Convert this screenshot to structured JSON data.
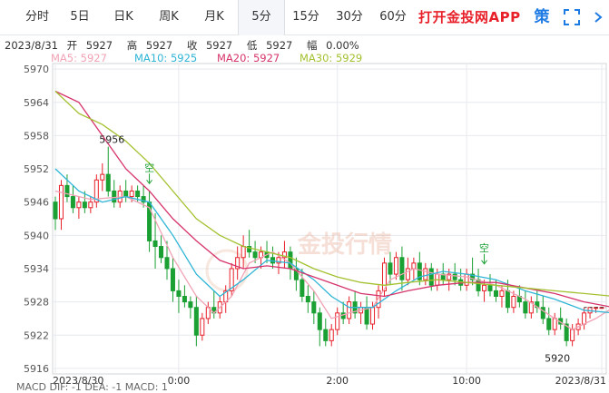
{
  "tabs": [
    {
      "label": "分时",
      "active": false
    },
    {
      "label": "5日",
      "active": false
    },
    {
      "label": "日K",
      "active": false
    },
    {
      "label": "周K",
      "active": false
    },
    {
      "label": "月K",
      "active": false
    },
    {
      "label": "5分",
      "active": true
    },
    {
      "label": "15分",
      "active": false
    },
    {
      "label": "30分",
      "active": false
    },
    {
      "label": "60分",
      "active": false
    }
  ],
  "app_link": "打开金投网APP",
  "strategy_icon_label": "策",
  "icons": {
    "strategy": "strategy-icon",
    "fullscreen": "fullscreen-icon"
  },
  "info": {
    "date": "2023/8/31",
    "open_label": "开",
    "open": "5927",
    "high_label": "高",
    "high": "5927",
    "close_label": "收",
    "close": "5927",
    "low_label": "低",
    "low": "5927",
    "amp_label": "幅",
    "amp": "0.00%"
  },
  "ma_legend": [
    {
      "label": "MA5: 5927",
      "color": "#f0a3b5"
    },
    {
      "label": "MA10: 5925",
      "color": "#2fb5d6"
    },
    {
      "label": "MA20: 5927",
      "color": "#d6336c"
    },
    {
      "label": "MA30: 5929",
      "color": "#a3c130"
    }
  ],
  "bottom_partial": "MACD  DIF: -1    DEA: -1    MACD: 1",
  "chart_data": {
    "type": "candlestick",
    "ylim": [
      5915,
      5971
    ],
    "yticks": [
      5916,
      5922,
      5928,
      5934,
      5940,
      5946,
      5952,
      5958,
      5964,
      5970
    ],
    "xticks": [
      {
        "label": "2023/8/30",
        "index": 0
      },
      {
        "label": "0:00",
        "index": 21
      },
      {
        "label": "2:00",
        "index": 48
      },
      {
        "label": "10:00",
        "index": 70
      },
      {
        "label": "2023/8/31",
        "index": 93
      }
    ],
    "annotations": [
      {
        "text": "5956",
        "index": 9,
        "value": 5956,
        "kind": "high"
      },
      {
        "text": "5920",
        "index": 87,
        "value": 5920,
        "kind": "low"
      },
      {
        "text": "空",
        "index": 16,
        "value": 5950,
        "kind": "signal"
      },
      {
        "text": "空",
        "index": 73,
        "value": 5935.5,
        "kind": "signal"
      }
    ],
    "last_price": 5927,
    "colors": {
      "up": "#e8202a",
      "down": "#1aa033",
      "grid": "#e6e9ee",
      "axis": "#999999"
    },
    "candles": [
      [
        5946,
        5947,
        5941,
        5943
      ],
      [
        5943,
        5950,
        5941,
        5949
      ],
      [
        5949,
        5951,
        5946,
        5947
      ],
      [
        5947,
        5949,
        5944,
        5945
      ],
      [
        5945,
        5947,
        5943,
        5946
      ],
      [
        5946,
        5948,
        5944,
        5945
      ],
      [
        5945,
        5947,
        5944,
        5946
      ],
      [
        5946,
        5951,
        5945,
        5950
      ],
      [
        5950,
        5953,
        5948,
        5951
      ],
      [
        5951,
        5956,
        5947,
        5948
      ],
      [
        5948,
        5950,
        5945,
        5946
      ],
      [
        5946,
        5949,
        5945,
        5948
      ],
      [
        5948,
        5950,
        5946,
        5947
      ],
      [
        5947,
        5949,
        5946,
        5948
      ],
      [
        5948,
        5949,
        5946,
        5947
      ],
      [
        5947,
        5949,
        5945,
        5946
      ],
      [
        5946,
        5948,
        5937,
        5939
      ],
      [
        5939,
        5944,
        5934,
        5938
      ],
      [
        5938,
        5940,
        5935,
        5936
      ],
      [
        5936,
        5939,
        5932,
        5934
      ],
      [
        5934,
        5936,
        5928,
        5930
      ],
      [
        5930,
        5932,
        5926,
        5929
      ],
      [
        5929,
        5931,
        5927,
        5928
      ],
      [
        5928,
        5929,
        5925,
        5927
      ],
      [
        5927,
        5929,
        5920,
        5922
      ],
      [
        5922,
        5926,
        5921,
        5925
      ],
      [
        5925,
        5928,
        5924,
        5927
      ],
      [
        5927,
        5930,
        5925,
        5926
      ],
      [
        5926,
        5929,
        5925,
        5928
      ],
      [
        5928,
        5931,
        5926,
        5930
      ],
      [
        5930,
        5935,
        5929,
        5934
      ],
      [
        5934,
        5938,
        5932,
        5936
      ],
      [
        5936,
        5940,
        5934,
        5938
      ],
      [
        5938,
        5941,
        5936,
        5937
      ],
      [
        5937,
        5939,
        5935,
        5936
      ],
      [
        5936,
        5938,
        5934,
        5937
      ],
      [
        5937,
        5939,
        5935,
        5936
      ],
      [
        5936,
        5938,
        5934,
        5935
      ],
      [
        5935,
        5937,
        5933,
        5936
      ],
      [
        5936,
        5939,
        5934,
        5937
      ],
      [
        5937,
        5938,
        5932,
        5934
      ],
      [
        5934,
        5936,
        5930,
        5932
      ],
      [
        5932,
        5934,
        5928,
        5929
      ],
      [
        5929,
        5931,
        5926,
        5928
      ],
      [
        5928,
        5930,
        5924,
        5926
      ],
      [
        5926,
        5927,
        5920,
        5923
      ],
      [
        5923,
        5925,
        5920,
        5921
      ],
      [
        5921,
        5924,
        5920,
        5923
      ],
      [
        5923,
        5927,
        5922,
        5926
      ],
      [
        5926,
        5928,
        5924,
        5925
      ],
      [
        5925,
        5929,
        5924,
        5928
      ],
      [
        5928,
        5930,
        5925,
        5926
      ],
      [
        5926,
        5928,
        5924,
        5927
      ],
      [
        5927,
        5929,
        5923,
        5924
      ],
      [
        5924,
        5928,
        5923,
        5927
      ],
      [
        5927,
        5931,
        5925,
        5930
      ],
      [
        5930,
        5936,
        5929,
        5935
      ],
      [
        5935,
        5937,
        5931,
        5933
      ],
      [
        5933,
        5937,
        5932,
        5936
      ],
      [
        5936,
        5938,
        5930,
        5932
      ],
      [
        5932,
        5936,
        5931,
        5934
      ],
      [
        5934,
        5936,
        5932,
        5935
      ],
      [
        5935,
        5937,
        5931,
        5932
      ],
      [
        5932,
        5935,
        5931,
        5934
      ],
      [
        5934,
        5935,
        5930,
        5931
      ],
      [
        5931,
        5934,
        5930,
        5933
      ],
      [
        5933,
        5935,
        5931,
        5932
      ],
      [
        5932,
        5934,
        5930,
        5933
      ],
      [
        5933,
        5935,
        5931,
        5932
      ],
      [
        5932,
        5934,
        5930,
        5931
      ],
      [
        5931,
        5934,
        5930,
        5933
      ],
      [
        5933,
        5936,
        5931,
        5932
      ],
      [
        5932,
        5934,
        5929,
        5930
      ],
      [
        5930,
        5932,
        5928,
        5931
      ],
      [
        5931,
        5933,
        5929,
        5930
      ],
      [
        5930,
        5932,
        5928,
        5929
      ],
      [
        5929,
        5931,
        5927,
        5930
      ],
      [
        5930,
        5932,
        5926,
        5927
      ],
      [
        5927,
        5930,
        5926,
        5929
      ],
      [
        5929,
        5931,
        5927,
        5928
      ],
      [
        5928,
        5930,
        5925,
        5926
      ],
      [
        5926,
        5929,
        5925,
        5928
      ],
      [
        5928,
        5930,
        5926,
        5927
      ],
      [
        5927,
        5929,
        5924,
        5925
      ],
      [
        5925,
        5927,
        5922,
        5923
      ],
      [
        5923,
        5926,
        5922,
        5925
      ],
      [
        5925,
        5927,
        5923,
        5924
      ],
      [
        5924,
        5925,
        5920,
        5921
      ],
      [
        5921,
        5924,
        5920,
        5923
      ],
      [
        5923,
        5925,
        5922,
        5924
      ],
      [
        5924,
        5927,
        5923,
        5926
      ],
      [
        5926,
        5927,
        5925,
        5927
      ],
      [
        5927,
        5927,
        5926,
        5927
      ],
      [
        5927,
        5927,
        5927,
        5927
      ]
    ],
    "ma_series": [
      {
        "name": "MA5",
        "color": "#f0a3b5",
        "points": [
          [
            0,
            5948
          ],
          [
            6,
            5946.5
          ],
          [
            12,
            5947
          ],
          [
            16,
            5945
          ],
          [
            20,
            5936
          ],
          [
            24,
            5929
          ],
          [
            27,
            5926
          ],
          [
            30,
            5929
          ],
          [
            33,
            5935
          ],
          [
            37,
            5937
          ],
          [
            40,
            5935
          ],
          [
            44,
            5930
          ],
          [
            47,
            5925
          ],
          [
            50,
            5926
          ],
          [
            54,
            5927
          ],
          [
            57,
            5932
          ],
          [
            61,
            5934
          ],
          [
            65,
            5933
          ],
          [
            70,
            5932.5
          ],
          [
            75,
            5931
          ],
          [
            80,
            5928.5
          ],
          [
            85,
            5925
          ],
          [
            88,
            5923
          ],
          [
            92,
            5925
          ],
          [
            95,
            5927
          ]
        ]
      },
      {
        "name": "MA10",
        "color": "#2fb5d6",
        "points": [
          [
            0,
            5952
          ],
          [
            4,
            5948
          ],
          [
            8,
            5946
          ],
          [
            12,
            5947
          ],
          [
            16,
            5946
          ],
          [
            20,
            5940
          ],
          [
            24,
            5933
          ],
          [
            28,
            5929
          ],
          [
            32,
            5932
          ],
          [
            36,
            5935.5
          ],
          [
            40,
            5935
          ],
          [
            44,
            5932
          ],
          [
            47,
            5929
          ],
          [
            50,
            5927
          ],
          [
            54,
            5927
          ],
          [
            58,
            5930
          ],
          [
            62,
            5932.5
          ],
          [
            66,
            5933.5
          ],
          [
            70,
            5933
          ],
          [
            75,
            5932
          ],
          [
            80,
            5930
          ],
          [
            85,
            5928.5
          ],
          [
            90,
            5926.5
          ],
          [
            95,
            5926
          ]
        ]
      },
      {
        "name": "MA20",
        "color": "#d6336c",
        "points": [
          [
            0,
            5966
          ],
          [
            4,
            5964
          ],
          [
            8,
            5958
          ],
          [
            12,
            5952
          ],
          [
            16,
            5948
          ],
          [
            20,
            5943
          ],
          [
            24,
            5939
          ],
          [
            28,
            5935.5
          ],
          [
            32,
            5934
          ],
          [
            36,
            5934.5
          ],
          [
            40,
            5934
          ],
          [
            44,
            5932.5
          ],
          [
            48,
            5931
          ],
          [
            52,
            5929.5
          ],
          [
            56,
            5929
          ],
          [
            60,
            5930
          ],
          [
            65,
            5931
          ],
          [
            70,
            5931.5
          ],
          [
            75,
            5931.5
          ],
          [
            80,
            5930.5
          ],
          [
            85,
            5929.5
          ],
          [
            90,
            5928
          ],
          [
            95,
            5927
          ]
        ]
      },
      {
        "name": "MA30",
        "color": "#a3c130",
        "points": [
          [
            0,
            5966
          ],
          [
            4,
            5962
          ],
          [
            8,
            5960
          ],
          [
            12,
            5957
          ],
          [
            16,
            5953
          ],
          [
            20,
            5948
          ],
          [
            24,
            5943
          ],
          [
            28,
            5940
          ],
          [
            32,
            5938
          ],
          [
            36,
            5937
          ],
          [
            40,
            5936
          ],
          [
            44,
            5934
          ],
          [
            48,
            5932.5
          ],
          [
            52,
            5931.5
          ],
          [
            56,
            5931
          ],
          [
            60,
            5931.5
          ],
          [
            65,
            5932
          ],
          [
            70,
            5931.5
          ],
          [
            75,
            5931
          ],
          [
            80,
            5930.5
          ],
          [
            85,
            5930
          ],
          [
            90,
            5929.5
          ],
          [
            95,
            5929
          ]
        ]
      }
    ],
    "watermark": "金投行情"
  }
}
